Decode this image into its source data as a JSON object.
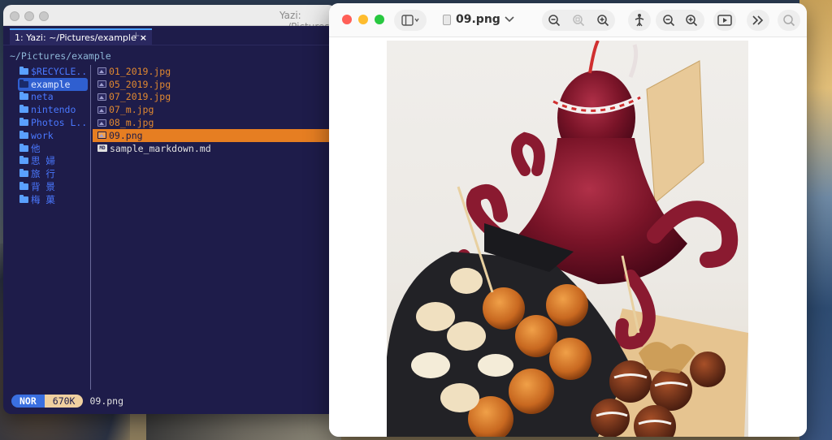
{
  "terminal": {
    "title": "Yazi: ~/Pictures/example",
    "tab_label": "1: Yazi: ~/Pictures/example",
    "tab_close": "×",
    "new_tab": "+",
    "path": "~/Pictures/example",
    "parent_dirs": [
      "$RECYCLE...",
      "example",
      "neta",
      "nintendo",
      "Photos L...",
      "work",
      "他",
      "思 婦",
      "旅 行",
      "背 景",
      "梅 菓"
    ],
    "files": [
      "01_2019.jpg",
      "05_2019.jpg",
      "07_2019.jpg",
      "07_m.jpg",
      "08_m.jpg",
      "09.png",
      "sample_markdown.md"
    ],
    "md_icon": "MD",
    "status_mode": "NOR",
    "status_size": "670K",
    "status_name": "09.png"
  },
  "preview": {
    "doc_title": "09.png",
    "icons": [
      "sidebar-icon",
      "zoom-out-icon",
      "zoom-fit-icon",
      "zoom-in-icon",
      "share-icon",
      "zoom-out-icon",
      "zoom-in-icon",
      "slideshow-icon",
      "more-icon",
      "search-icon"
    ]
  },
  "colors": {
    "terminal_bg": "#1e1c4a",
    "accent_orange": "#e67e22",
    "accent_blue": "#3a6fe0",
    "dir_blue": "#4a78ff"
  }
}
